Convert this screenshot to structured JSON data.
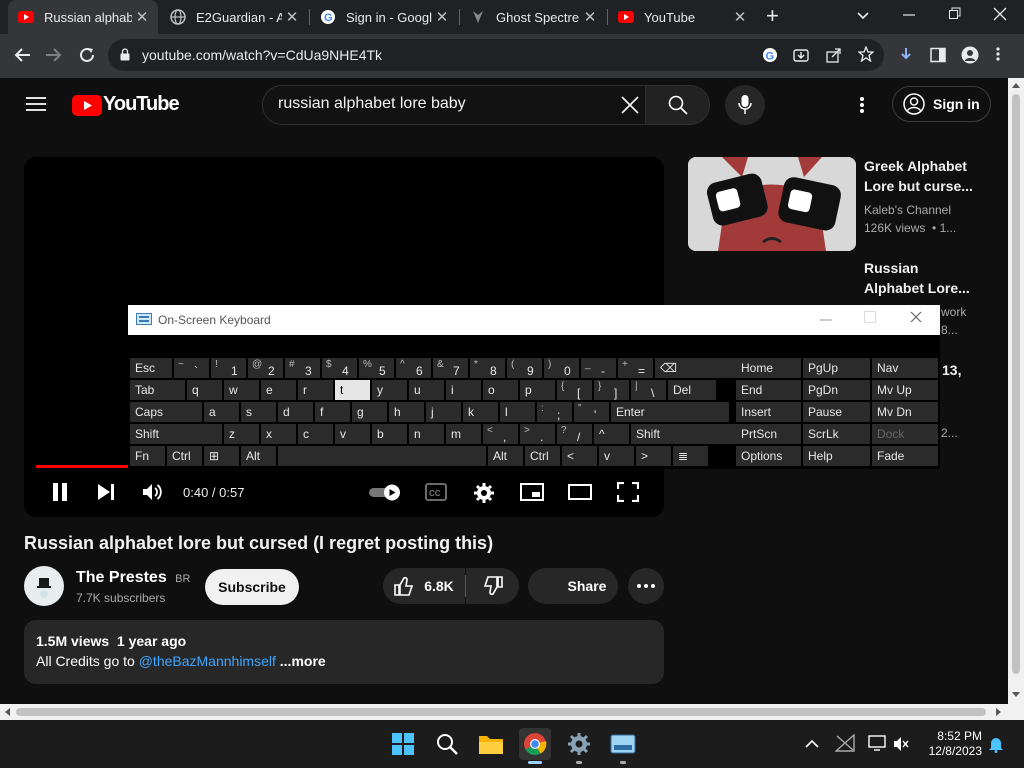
{
  "tabs": [
    {
      "title": "Russian alphab",
      "close": "✕"
    },
    {
      "title": "E2Guardian - A",
      "close": "✕"
    },
    {
      "title": "Sign in - Googl",
      "close": "✕"
    },
    {
      "title": "Ghost Spectre",
      "close": "✕"
    },
    {
      "title": "YouTube",
      "close": "✕"
    }
  ],
  "browser": {
    "url": "youtube.com/watch?v=CdUa9NHE4Tk",
    "new_tab": "+"
  },
  "youtube": {
    "logo_text": "YouTube",
    "search_value": "russian alphabet lore baby",
    "sign_in": "Sign in"
  },
  "video": {
    "time": "0:40 / 0:57",
    "progress_fraction": 0.7,
    "title": "Russian alphabet lore but cursed (I regret posting this)",
    "channel": "The Prestes",
    "channel_badge": "BR",
    "subscribers": "7.7K subscribers",
    "subscribe": "Subscribe",
    "likes": "6.8K",
    "share": "Share",
    "views_line": "1.5M views  1 year ago",
    "desc_prefix": "All Credits go to ",
    "desc_link": "@theBazMannhimself",
    "desc_more": " ...more"
  },
  "related": [
    {
      "title_l1": "Greek Alphabet",
      "title_l2": "Lore but curse...",
      "channel": "Kaleb's Channel",
      "meta": "126K views  • 1..."
    },
    {
      "title_l1": "Russian",
      "title_l2": "Alphabet Lore...",
      "channel": "work",
      "meta": "8..."
    },
    {
      "title_frag": "13,",
      "meta_frag": "2..."
    }
  ],
  "osk": {
    "title": "On-Screen Keyboard",
    "rows": [
      [
        [
          "Esc",
          ""
        ],
        [
          "~",
          "`"
        ],
        [
          "!",
          "1"
        ],
        [
          "@",
          "2"
        ],
        [
          "#",
          "3"
        ],
        [
          "$",
          "4"
        ],
        [
          "%",
          "5"
        ],
        [
          "^",
          "6"
        ],
        [
          "&",
          "7"
        ],
        [
          "*",
          "8"
        ],
        [
          "(",
          "9"
        ],
        [
          ")",
          "0"
        ],
        [
          "_",
          "-"
        ],
        [
          "+",
          "="
        ],
        [
          "⌫",
          ""
        ]
      ],
      [
        [
          "Tab",
          ""
        ],
        [
          "q",
          ""
        ],
        [
          "w",
          ""
        ],
        [
          "e",
          ""
        ],
        [
          "r",
          ""
        ],
        [
          "t",
          ""
        ],
        [
          "y",
          ""
        ],
        [
          "u",
          ""
        ],
        [
          "i",
          ""
        ],
        [
          "o",
          ""
        ],
        [
          "p",
          ""
        ],
        [
          "{",
          "["
        ],
        [
          "}",
          "]"
        ],
        [
          "|",
          "\\"
        ],
        [
          "Del",
          ""
        ]
      ],
      [
        [
          "Caps",
          ""
        ],
        [
          "a",
          ""
        ],
        [
          "s",
          ""
        ],
        [
          "d",
          ""
        ],
        [
          "f",
          ""
        ],
        [
          "g",
          ""
        ],
        [
          "h",
          ""
        ],
        [
          "j",
          ""
        ],
        [
          "k",
          ""
        ],
        [
          "l",
          ""
        ],
        [
          ":",
          ";"
        ],
        [
          "\"",
          "'"
        ],
        [
          "Enter",
          ""
        ]
      ],
      [
        [
          "Shift",
          ""
        ],
        [
          "z",
          ""
        ],
        [
          "x",
          ""
        ],
        [
          "c",
          ""
        ],
        [
          "v",
          ""
        ],
        [
          "b",
          ""
        ],
        [
          "n",
          ""
        ],
        [
          "m",
          ""
        ],
        [
          "<",
          ","
        ],
        [
          ">",
          "."
        ],
        [
          "?",
          "/"
        ],
        [
          "^",
          ""
        ],
        [
          "Shift",
          ""
        ]
      ],
      [
        [
          "Fn",
          ""
        ],
        [
          "Ctrl",
          ""
        ],
        [
          "⊞",
          ""
        ],
        [
          "Alt",
          ""
        ],
        [
          "",
          ""
        ],
        [
          "Alt",
          ""
        ],
        [
          "Ctrl",
          ""
        ],
        [
          "<",
          ""
        ],
        [
          "v",
          ""
        ],
        [
          ">",
          ""
        ],
        [
          "≣",
          ""
        ]
      ]
    ],
    "nav": [
      [
        "Home",
        "PgUp",
        "Nav"
      ],
      [
        "End",
        "PgDn",
        "Mv Up"
      ],
      [
        "Insert",
        "Pause",
        "Mv Dn"
      ],
      [
        "PrtScn",
        "ScrLk",
        "Dock"
      ],
      [
        "Options",
        "Help",
        "Fade"
      ]
    ]
  },
  "taskbar": {
    "time": "8:52 PM",
    "date": "12/8/2023"
  }
}
